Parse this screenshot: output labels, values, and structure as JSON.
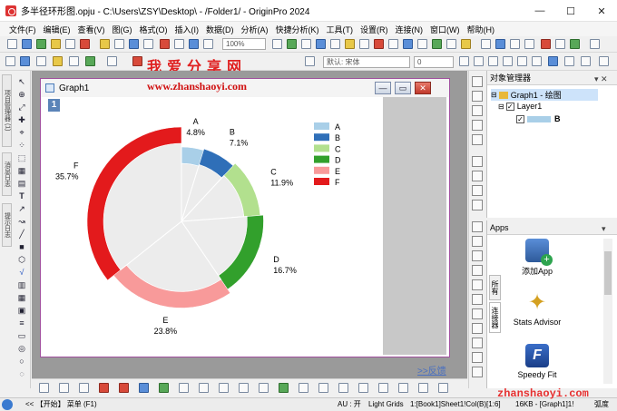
{
  "window": {
    "title": "多半径环形图.opju - C:\\Users\\ZSY\\Desktop\\ - /Folder1/ - OriginPro 2024",
    "minimize": "—",
    "maximize": "☐",
    "close": "✕"
  },
  "menu": [
    "文件(F)",
    "编辑(E)",
    "查看(V)",
    "图(G)",
    "格式(O)",
    "插入(I)",
    "数据(D)",
    "分析(A)",
    "快捷分析(K)",
    "工具(T)",
    "设置(R)",
    "连接(N)",
    "窗口(W)",
    "帮助(H)"
  ],
  "toolbar": {
    "zoom": "100%",
    "font_name": "默认: 宋体",
    "font_size": "0"
  },
  "watermark": {
    "banner": "我爱分享网",
    "url": "www.zhanshaoyi.com",
    "site": "zhanshaoyi.com"
  },
  "graph_window": {
    "title": "Graph1",
    "layer_badge": "1",
    "min": "—",
    "restore": "▭",
    "close": "✕"
  },
  "chart_data": {
    "type": "pie",
    "variant": "multi-radius donut",
    "categories": [
      "A",
      "B",
      "C",
      "D",
      "E",
      "F"
    ],
    "values": [
      4.8,
      7.1,
      11.9,
      16.7,
      23.8,
      35.7
    ],
    "percent_labels": [
      "4.8%",
      "7.1%",
      "11.9%",
      "16.7%",
      "23.8%",
      "35.7%"
    ],
    "colors": [
      "#a9cfe8",
      "#2f6fb8",
      "#b2e08e",
      "#32a02c",
      "#f89a9a",
      "#e31a1c"
    ],
    "legend": {
      "position": "top-right",
      "entries": [
        "A",
        "B",
        "C",
        "D",
        "E",
        "F"
      ]
    }
  },
  "feedback_link": ">>反馈",
  "object_manager": {
    "title": "对象管理器",
    "pin": "▾ ✕",
    "items": [
      {
        "label": "Graph1 - 绘图"
      },
      {
        "label": "Layer1"
      },
      {
        "label": "B"
      }
    ]
  },
  "apps": {
    "title": "Apps",
    "tab_all": "所有",
    "tab_connector": "连接器",
    "items": [
      {
        "label": "添加App",
        "icon": "add-app-icon"
      },
      {
        "label": "Stats Advisor",
        "icon": "stats-advisor-icon"
      },
      {
        "label": "Speedy Fit",
        "icon": "speedy-fit-icon"
      }
    ]
  },
  "left_tabs": [
    "项目管理器 (1)",
    "消息日志",
    "提示日志"
  ],
  "status": {
    "start": "<< 【开始】 菜单 (F1)",
    "au": "AU : 开",
    "grids": "Light Grids",
    "cell": "1:[Book1]Sheet1!Col(B)[1:6]",
    "size": "16KB - [Graph1]1!",
    "unit": "弧度"
  }
}
